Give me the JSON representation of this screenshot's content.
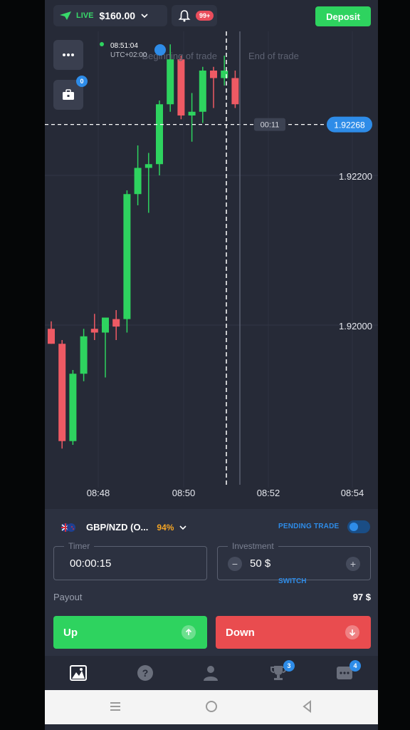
{
  "topbar": {
    "account_mode": "LIVE",
    "balance": "$160.00",
    "notification_badge": "99+",
    "deposit_label": "Deposit"
  },
  "chart": {
    "menu_icon": "dots-icon",
    "portfolio_badge": "0",
    "time_label": "08:51:04",
    "time_sub": "UTC+02:00",
    "beginning_label": "Beginning of trade",
    "end_label": "End of trade",
    "countdown": "00:11",
    "current_price": "1.92268",
    "price_ticks": [
      "1.92200",
      "1.92000"
    ],
    "time_ticks": [
      "08:48",
      "08:50",
      "08:52",
      "08:54"
    ],
    "colors": {
      "up": "#2ed35f",
      "down": "#ee5a64",
      "background": "#262a37"
    },
    "candles": [
      {
        "o": 1.91995,
        "c": 1.91975,
        "h": 1.92005,
        "l": 1.91975
      },
      {
        "o": 1.91975,
        "c": 1.91845,
        "h": 1.9198,
        "l": 1.91835
      },
      {
        "o": 1.91845,
        "c": 1.91935,
        "h": 1.9194,
        "l": 1.9184
      },
      {
        "o": 1.91935,
        "c": 1.91985,
        "h": 1.91995,
        "l": 1.91925
      },
      {
        "o": 1.91995,
        "c": 1.9199,
        "h": 1.92015,
        "l": 1.9198
      },
      {
        "o": 1.9199,
        "c": 1.9201,
        "h": 1.9201,
        "l": 1.9193
      },
      {
        "o": 1.92008,
        "c": 1.91998,
        "h": 1.9202,
        "l": 1.9198
      },
      {
        "o": 1.92008,
        "c": 1.92175,
        "h": 1.9218,
        "l": 1.9199
      },
      {
        "o": 1.92175,
        "c": 1.9221,
        "h": 1.9224,
        "l": 1.9216
      },
      {
        "o": 1.9221,
        "c": 1.92215,
        "h": 1.9223,
        "l": 1.9215
      },
      {
        "o": 1.92215,
        "c": 1.92295,
        "h": 1.923,
        "l": 1.922
      },
      {
        "o": 1.92295,
        "c": 1.92355,
        "h": 1.92375,
        "l": 1.92285
      },
      {
        "o": 1.92355,
        "c": 1.9228,
        "h": 1.9236,
        "l": 1.92275
      },
      {
        "o": 1.9228,
        "c": 1.92285,
        "h": 1.9231,
        "l": 1.92245
      },
      {
        "o": 1.92285,
        "c": 1.9234,
        "h": 1.92345,
        "l": 1.9227
      },
      {
        "o": 1.9234,
        "c": 1.9233,
        "h": 1.92345,
        "l": 1.9229
      },
      {
        "o": 1.9233,
        "c": 1.9234,
        "h": 1.9236,
        "l": 1.9232
      },
      {
        "o": 1.9233,
        "c": 1.92295,
        "h": 1.9234,
        "l": 1.9229
      }
    ]
  },
  "panel": {
    "pair": "GBP/NZD (O...",
    "payout_pct": "94%",
    "pending_label": "PENDING TRADE",
    "timer_label": "Timer",
    "timer_value": "00:00:15",
    "investment_label": "Investment",
    "investment_value": "50 $",
    "minus": "−",
    "plus": "+",
    "switch_label": "SWITCH",
    "payout_label": "Payout",
    "payout_value": "97 $",
    "up_label": "Up",
    "down_label": "Down",
    "up_color": "#2ed35f",
    "down_color": "#e94c4f"
  },
  "bottomnav": {
    "items": [
      "chart-icon",
      "help-icon",
      "profile-icon",
      "trophy-icon",
      "chat-icon"
    ],
    "trophy_badge": "3",
    "chat_badge": "4"
  }
}
